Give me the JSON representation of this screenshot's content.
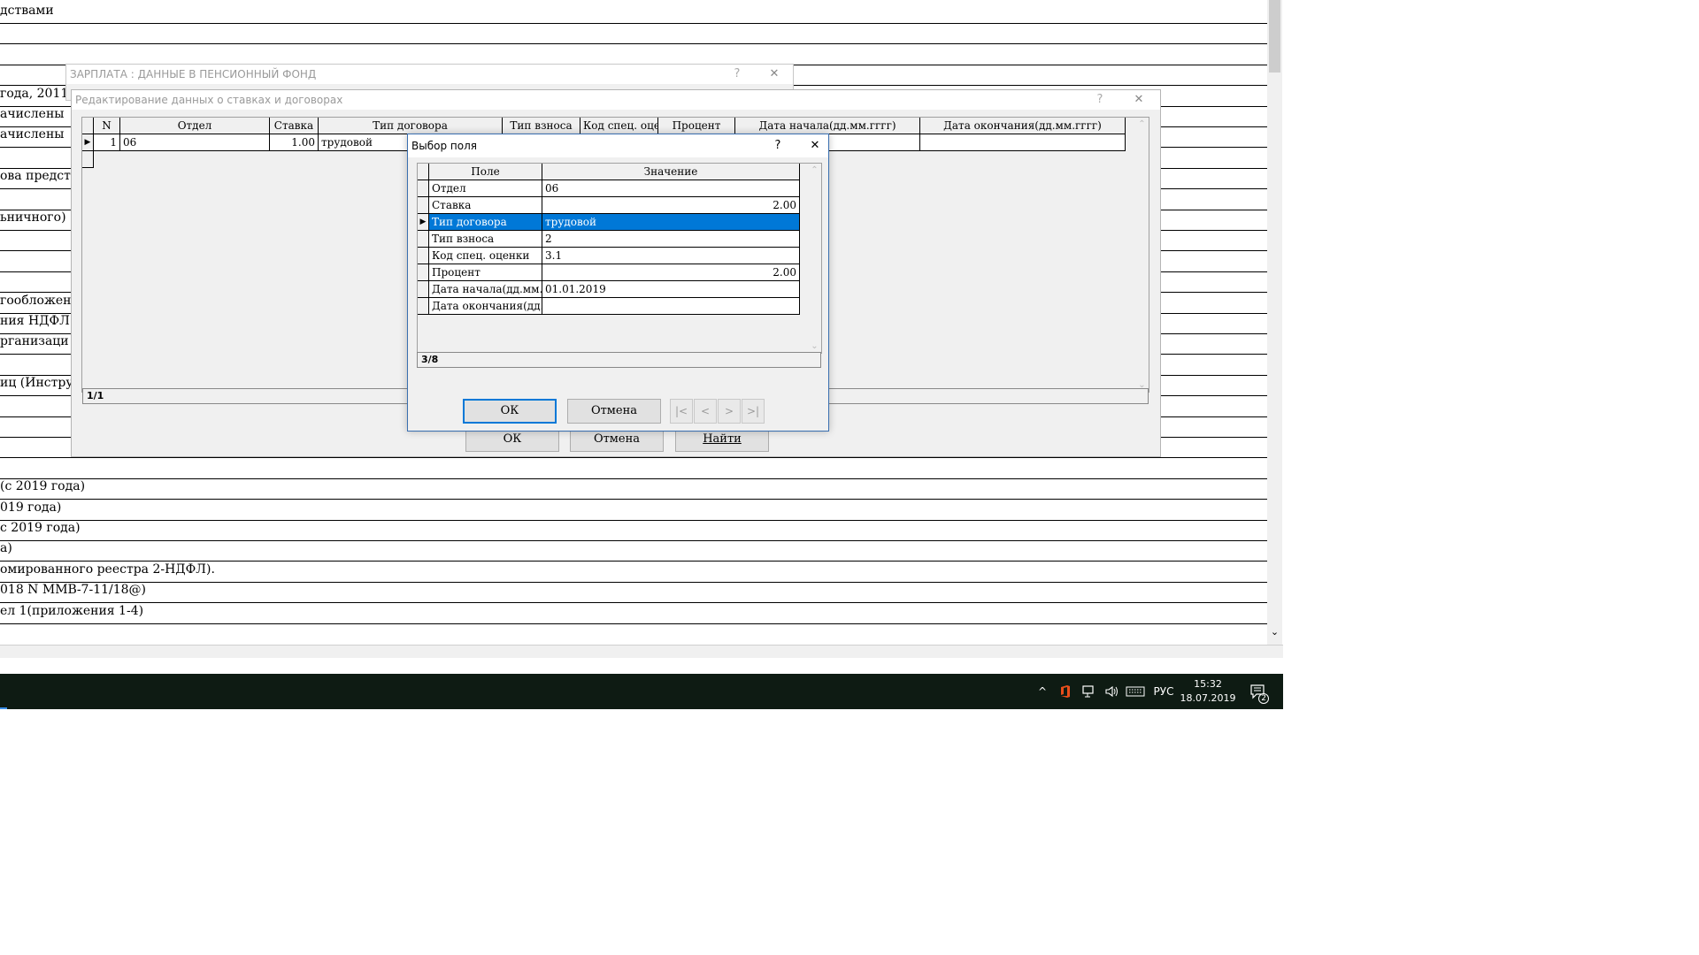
{
  "background_doc": {
    "lines": [
      "дствами",
      "",
      "",
      "",
      " года, 2011",
      "ачислены",
      "ачислены",
      "",
      "ова предст",
      "",
      "ьничного)",
      "",
      "",
      "",
      "гообложен",
      "ния НДФЛ",
      "рганизаци",
      "",
      "иц (Инстру",
      "",
      "",
      "",
      "",
      " (с 2019 года)",
      "019 года)",
      "с 2019 года)",
      "а)",
      "омированного реестра 2-НДФЛ).",
      "018 N ММВ-7-11/18@)",
      "ел 1(приложения 1-4)"
    ]
  },
  "pension_window": {
    "title": "ЗАРПЛАТА : ДАННЫЕ В ПЕНСИОННЫЙ ФОНД",
    "help": "?",
    "close": "✕"
  },
  "edit_window": {
    "title": "Редактирование данных о ставках и договорах",
    "help": "?",
    "close": "✕",
    "columns": [
      "N",
      "Отдел",
      "Ставка",
      "Тип договора",
      "Тип взноса",
      "Код спец. оце",
      "Процент",
      "Дата начала(дд.мм.гггг)",
      "Дата окончания(дд.мм.гггг)"
    ],
    "rows": [
      {
        "n": "1",
        "dept": "06",
        "rate": "1.00",
        "contract": "трудовой"
      }
    ],
    "record_counter": "1/1",
    "ok": "ОК",
    "cancel": "Отмена",
    "find": "Найти"
  },
  "field_dialog": {
    "title": "Выбор поля",
    "help": "?",
    "close": "✕",
    "col_field": "Поле",
    "col_value": "Значение",
    "rows": [
      {
        "field": "Отдел",
        "value": "06",
        "align": "left"
      },
      {
        "field": "Ставка",
        "value": "2.00",
        "align": "right"
      },
      {
        "field": "Тип договора",
        "value": "трудовой",
        "align": "left",
        "selected": true
      },
      {
        "field": "Тип взноса",
        "value": "2",
        "align": "left"
      },
      {
        "field": "Код спец. оценки",
        "value": "3.1",
        "align": "left"
      },
      {
        "field": "Процент",
        "value": "2.00",
        "align": "right"
      },
      {
        "field": "Дата начала(дд.мм.г",
        "value": "01.01.2019",
        "align": "left"
      },
      {
        "field": "Дата окончания(дд.",
        "value": "",
        "align": "left"
      }
    ],
    "record_counter": "3/8",
    "ok": "ОК",
    "cancel": "Отмена",
    "nav": [
      "|<",
      "<",
      ">",
      ">|"
    ]
  },
  "taskbar": {
    "tray_up": "^",
    "language": "РУС",
    "time": "15:32",
    "date": "18.07.2019",
    "notifications": "2",
    "colors": {
      "background": "#0e1b13",
      "office": "#e94e1b"
    }
  },
  "colors": {
    "selection": "#0078d7",
    "dialog_bg": "#f0f0f0"
  }
}
